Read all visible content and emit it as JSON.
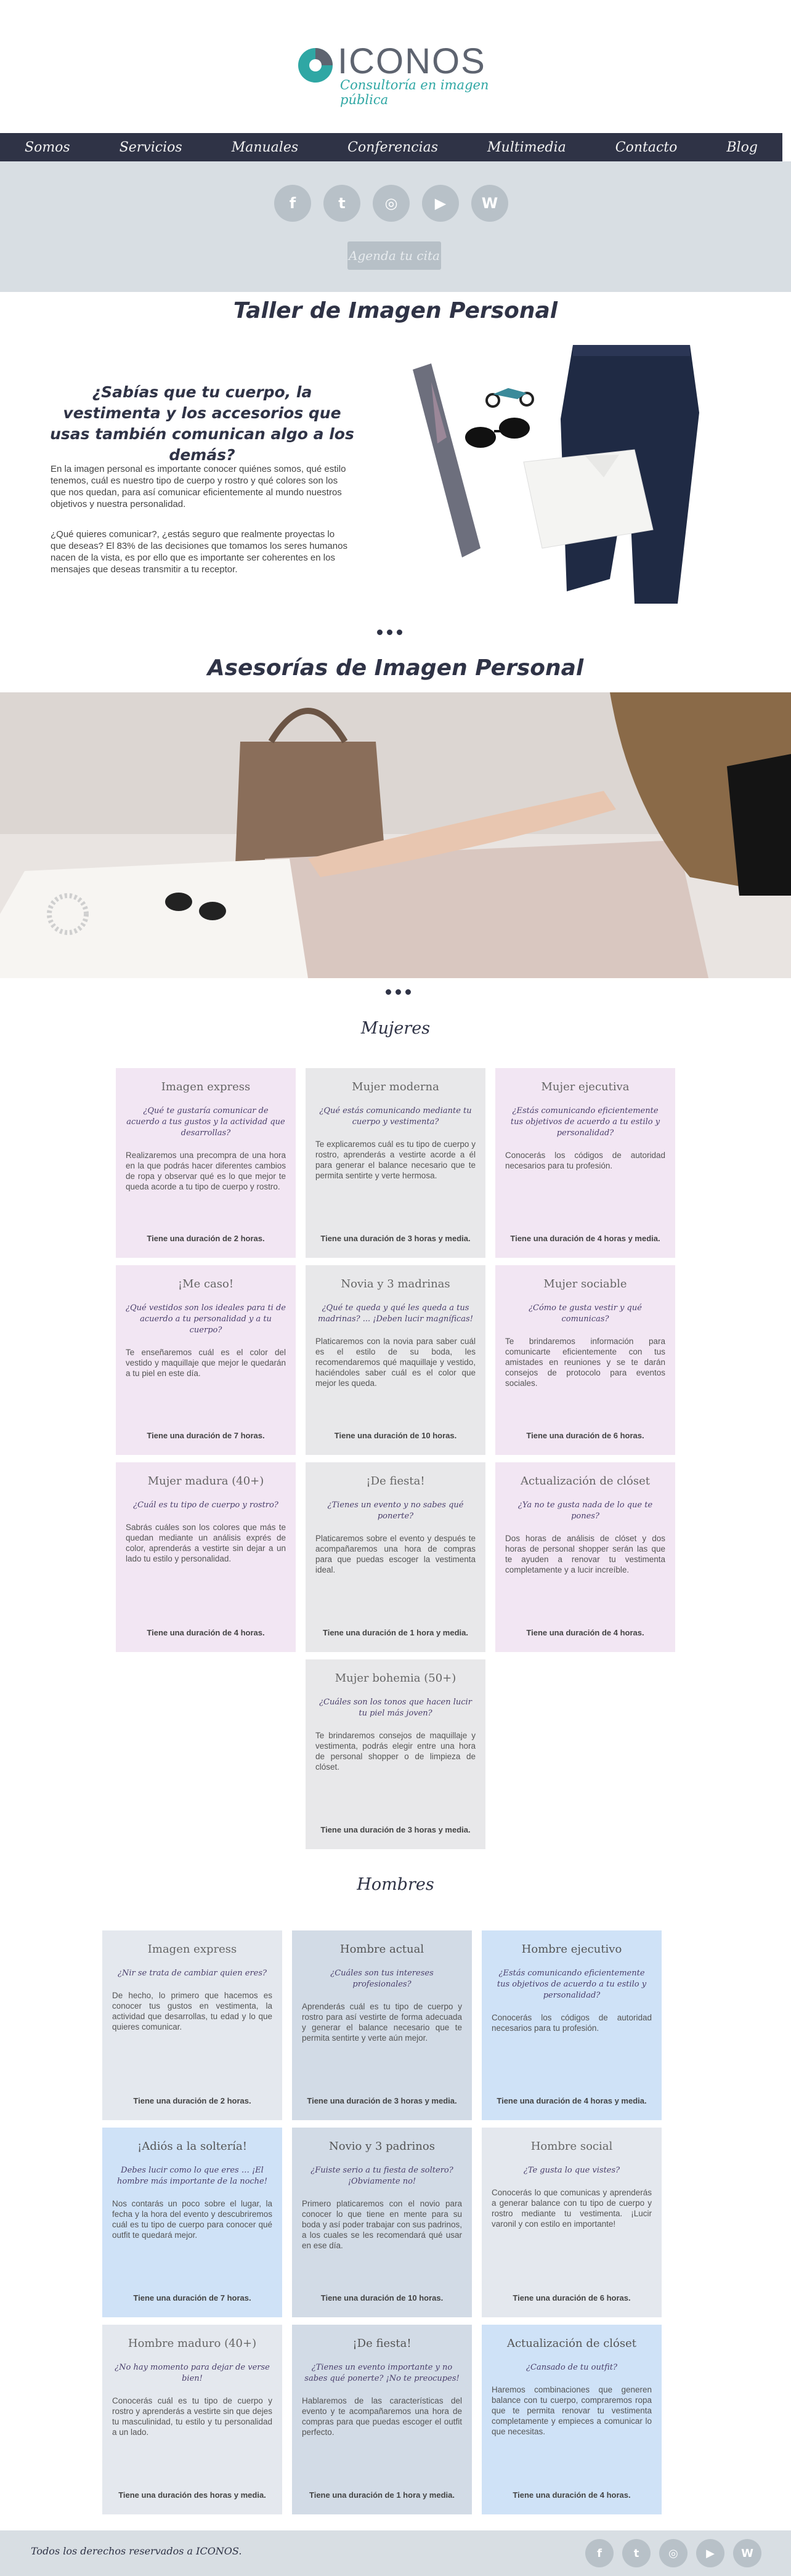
{
  "logo": {
    "brand": "ICONOS",
    "tagline": "Consultoría en imagen pública"
  },
  "nav": [
    "Somos",
    "Servicios",
    "Manuales",
    "Conferencias",
    "Multimedia",
    "Contacto",
    "Blog"
  ],
  "social": [
    "facebook-icon",
    "twitter-icon",
    "instagram-icon",
    "youtube-icon",
    "wordpress-icon"
  ],
  "social_glyphs": {
    "facebook": "f",
    "twitter": "t",
    "instagram": "◎",
    "youtube": "▶",
    "wordpress": "W"
  },
  "agenda_label": "Agenda tu cita",
  "taller": {
    "title": "Taller de Imagen Personal",
    "question": "¿Sabías que tu cuerpo, la vestimenta y los accesorios que usas también comunican algo a los demás?",
    "p1": "En la imagen personal es importante conocer quiénes somos, qué estilo tenemos, cuál es nuestro tipo de cuerpo y rostro y qué colores son los que nos quedan, para así comunicar eficientemente al mundo nuestros objetivos y nuestra personalidad.",
    "p2": "¿Qué quieres comunicar?, ¿estás seguro que realmente proyectas lo que deseas? El 83% de las decisiones que tomamos los seres humanos nacen de la vista, es por ello que es importante ser coherentes en los mensajes que deseas transmitir a tu receptor."
  },
  "asesorias": {
    "title": "Asesorías de Imagen Personal"
  },
  "mujeres": {
    "title": "Mujeres",
    "cards": [
      {
        "title": "Imagen express",
        "q": "¿Qué te gustaría comunicar de acuerdo a tus gustos y la actividad que desarrollas?",
        "body": "Realizaremos una precompra de una hora en la que podrás hacer diferentes cambios de ropa y observar qué es lo que mejor te queda acorde a tu tipo de cuerpo y rostro.",
        "dur": "Tiene una duración de 2 horas."
      },
      {
        "title": "Mujer moderna",
        "q": "¿Qué estás comunicando mediante tu cuerpo y vestimenta?",
        "body": "Te explicaremos cuál es tu tipo de cuerpo y rostro, aprenderás a vestirte acorde a él para generar el balance necesario que te permita sentirte y verte hermosa.",
        "dur": "Tiene una duración de 3 horas y media."
      },
      {
        "title": "Mujer ejecutiva",
        "q": "¿Estás comunicando eficientemente tus objetivos de acuerdo a tu estilo y personalidad?",
        "body": "Conocerás los códigos de autoridad necesarios para tu profesión.",
        "dur": "Tiene una duración de 4 horas y media."
      },
      {
        "title": "¡Me caso!",
        "q": "¿Qué vestidos son los ideales para ti de acuerdo a tu personalidad y a tu cuerpo?",
        "body": "Te enseñaremos cuál es el color del vestido y maquillaje que mejor le quedarán a tu piel en este día.",
        "dur": "Tiene una duración de 7 horas."
      },
      {
        "title": "Novia y 3 madrinas",
        "q": "¿Qué te queda y qué les queda a tus madrinas? ... ¡Deben lucir magníficas!",
        "body": "Platicaremos con la novia para saber cuál es el estilo de su boda, les recomendaremos qué maquillaje y vestido, haciéndoles saber cuál es el color que mejor les queda.",
        "dur": "Tiene una duración de 10 horas."
      },
      {
        "title": "Mujer sociable",
        "q": "¿Cómo te gusta vestir y qué comunicas?",
        "body": "Te brindaremos información para comunicarte eficientemente con tus amistades en reuniones y se te darán consejos de protocolo para eventos sociales.",
        "dur": "Tiene una duración de 6 horas."
      },
      {
        "title": "Mujer madura (40+)",
        "q": "¿Cuál es tu tipo de cuerpo y rostro?",
        "body": "Sabrás cuáles son los colores que más te quedan mediante un análisis exprés de color, aprenderás a vestirte sin dejar a un lado tu estilo y personalidad.",
        "dur": "Tiene una duración de 4 horas."
      },
      {
        "title": "¡De fiesta!",
        "q": "¿Tienes un evento y no sabes qué ponerte?",
        "body": "Platicaremos sobre el evento y después te acompañaremos una hora de compras para que puedas escoger la vestimenta ideal.",
        "dur": "Tiene una duración de 1 hora y media."
      },
      {
        "title": "Actualización de clóset",
        "q": "¿Ya no te gusta nada de lo que te pones?",
        "body": "Dos horas de análisis de clóset y dos horas de personal shopper serán las que te ayuden a renovar tu vestimenta completamente y a lucir increíble.",
        "dur": "Tiene una duración de 4 horas."
      },
      {
        "title": "Mujer bohemia (50+)",
        "q": "¿Cuáles son los tonos que hacen lucir tu piel más joven?",
        "body": "Te brindaremos consejos de maquillaje y vestimenta, podrás elegir entre una hora de personal shopper o de limpieza de clóset.",
        "dur": "Tiene una duración de 3 horas y media."
      }
    ]
  },
  "hombres": {
    "title": "Hombres",
    "cards": [
      {
        "title": "Imagen express",
        "q": "¿Nir se trata de cambiar quien eres?",
        "body": "De hecho, lo primero que hacemos es conocer tus gustos en vestimenta, la actividad que desarrollas, tu edad y lo que quieres comunicar.",
        "dur": "Tiene una duración de 2 horas."
      },
      {
        "title": "Hombre actual",
        "q": "¿Cuáles son tus intereses profesionales?",
        "body": "Aprenderás cuál es tu tipo de cuerpo y rostro para así vestirte de forma adecuada y generar el balance necesario que te permita sentirte y verte aún mejor.",
        "dur": "Tiene una duración de 3 horas y media."
      },
      {
        "title": "Hombre ejecutivo",
        "q": "¿Estás comunicando eficientemente tus objetivos de acuerdo a tu estilo y personalidad?",
        "body": "Conocerás los códigos de autoridad necesarios para tu profesión.",
        "dur": "Tiene una duración de 4 horas y media."
      },
      {
        "title": "¡Adiós a la soltería!",
        "q": "Debes lucir como lo que eres … ¡El hombre más importante de la noche!",
        "body": "Nos contarás un poco sobre el lugar, la fecha y la hora del evento y descubriremos cuál es tu tipo de cuerpo para conocer qué outfit te quedará mejor.",
        "dur": "Tiene una duración de 7 horas."
      },
      {
        "title": "Novio y 3 padrinos",
        "q": "¿Fuiste serio a tu fiesta de soltero? ¡Obviamente no!",
        "body": "Primero platicaremos con el novio para conocer lo que tiene en mente para su boda y así poder trabajar con sus padrinos, a los cuales se les recomendará qué usar en ese día.",
        "dur": "Tiene una duración de 10 horas."
      },
      {
        "title": "Hombre social",
        "q": "¿Te gusta lo que vistes?",
        "body": "Conocerás lo que comunicas y aprenderás a generar balance con tu tipo de cuerpo y rostro mediante tu vestimenta. ¡Lucir varonil y con estilo en importante!",
        "dur": "Tiene una duración de 6 horas."
      },
      {
        "title": "Hombre maduro (40+)",
        "q": "¿No hay momento para dejar de verse bien!",
        "body": "Conocerás cuál es tu tipo de cuerpo y rostro y aprenderás a vestirte sin que dejes tu masculinidad, tu estilo y tu personalidad a un lado.",
        "dur": "Tiene una duración des horas y media."
      },
      {
        "title": "¡De fiesta!",
        "q": "¿Tienes un evento importante y no sabes qué ponerte? ¡No te preocupes!",
        "body": "Hablaremos de las características del evento y te acompañaremos una hora de compras para que puedas escoger el outfit perfecto.",
        "dur": "Tiene una duración de 1 hora y media."
      },
      {
        "title": "Actualización de clóset",
        "q": "¿Cansado de tu outfit?",
        "body": "Haremos combinaciones que generen balance con tu cuerpo, compraremos ropa que te permita renovar tu vestimenta completamente y empieces a comunicar lo que necesitas.",
        "dur": "Tiene una duración de 4 horas."
      }
    ]
  },
  "footer": {
    "text": "Todos los derechos reservados a ICONOS."
  },
  "colors": {
    "nav_bg": "#2f3346",
    "band_bg": "#d8dee3",
    "accent": "#2fa7a4",
    "women_pink": "#f2e6f3",
    "women_gray": "#e8e8ea",
    "men_blue": "#cfe2f7",
    "men_gray": "#e4e8ee"
  }
}
